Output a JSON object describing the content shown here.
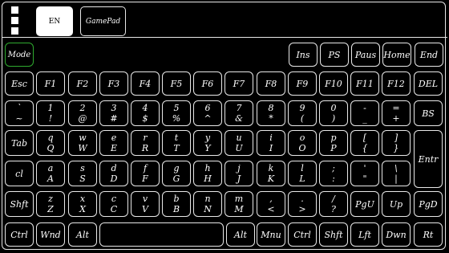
{
  "header": {
    "tabs": [
      {
        "label": "EN",
        "active": true
      },
      {
        "label": "GamePad",
        "active": false
      }
    ]
  },
  "keys": {
    "mode": "Mode",
    "ins": "Ins",
    "ps": "PS",
    "paus": "Paus",
    "home": "Home",
    "end": "End",
    "esc": "Esc",
    "f1": "F1",
    "f2": "F2",
    "f3": "F3",
    "f4": "F4",
    "f5": "F5",
    "f6": "F6",
    "f7": "F7",
    "f8": "F8",
    "f9": "F9",
    "f10": "F10",
    "f11": "F11",
    "f12": "F12",
    "del": "DEL",
    "num": [
      {
        "t": "`",
        "b": "~"
      },
      {
        "t": "1",
        "b": "!"
      },
      {
        "t": "2",
        "b": "@"
      },
      {
        "t": "3",
        "b": "#"
      },
      {
        "t": "4",
        "b": "$"
      },
      {
        "t": "5",
        "b": "%"
      },
      {
        "t": "6",
        "b": "^"
      },
      {
        "t": "7",
        "b": "&"
      },
      {
        "t": "8",
        "b": "*"
      },
      {
        "t": "9",
        "b": "("
      },
      {
        "t": "0",
        "b": ")"
      },
      {
        "t": "-",
        "b": "_"
      },
      {
        "t": "=",
        "b": "+"
      }
    ],
    "bs": "BS",
    "tab": "Tab",
    "qrow": [
      {
        "t": "q",
        "b": "Q"
      },
      {
        "t": "w",
        "b": "W"
      },
      {
        "t": "e",
        "b": "E"
      },
      {
        "t": "r",
        "b": "R"
      },
      {
        "t": "t",
        "b": "T"
      },
      {
        "t": "y",
        "b": "Y"
      },
      {
        "t": "u",
        "b": "U"
      },
      {
        "t": "i",
        "b": "I"
      },
      {
        "t": "o",
        "b": "O"
      },
      {
        "t": "p",
        "b": "P"
      },
      {
        "t": "[",
        "b": "{"
      },
      {
        "t": "]",
        "b": "}"
      }
    ],
    "entr": "Entr",
    "cl": "cl",
    "arow": [
      {
        "t": "a",
        "b": "A"
      },
      {
        "t": "s",
        "b": "S"
      },
      {
        "t": "d",
        "b": "D"
      },
      {
        "t": "f",
        "b": "F"
      },
      {
        "t": "g",
        "b": "G"
      },
      {
        "t": "h",
        "b": "H"
      },
      {
        "t": "j",
        "b": "J"
      },
      {
        "t": "k",
        "b": "K"
      },
      {
        "t": "l",
        "b": "L"
      },
      {
        "t": ";",
        "b": ":"
      },
      {
        "t": "'",
        "b": "\""
      },
      {
        "t": "\\",
        "b": "|"
      }
    ],
    "shft": "Shft",
    "zrow": [
      {
        "t": "z",
        "b": "Z"
      },
      {
        "t": "x",
        "b": "X"
      },
      {
        "t": "c",
        "b": "C"
      },
      {
        "t": "v",
        "b": "V"
      },
      {
        "t": "b",
        "b": "B"
      },
      {
        "t": "n",
        "b": "N"
      },
      {
        "t": "m",
        "b": "M"
      },
      {
        "t": ",",
        "b": "<"
      },
      {
        "t": ".",
        "b": ">"
      },
      {
        "t": "/",
        "b": "?"
      }
    ],
    "pgup": "PgU",
    "up": "Up",
    "pgdn": "PgD",
    "ctrl": "Ctrl",
    "wnd": "Wnd",
    "alt": "Alt",
    "altr": "Alt",
    "mnu": "Mnu",
    "ctrlr": "Ctrl",
    "shftr": "Shft",
    "lft": "Lft",
    "dwn": "Dwn",
    "rt": "Rt"
  }
}
